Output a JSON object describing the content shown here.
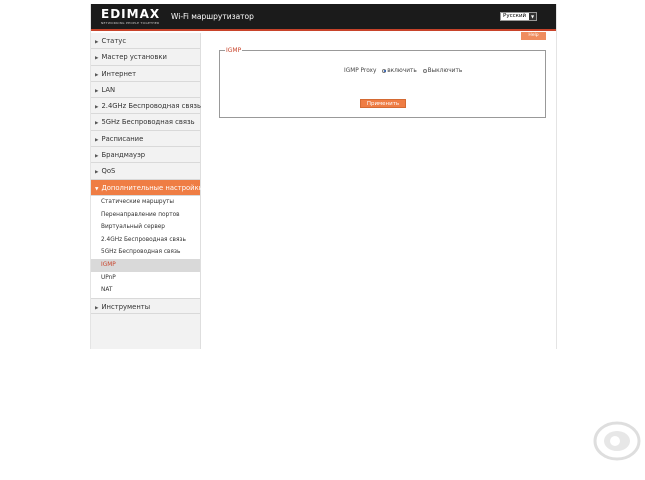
{
  "header": {
    "logo_text": "EDIMAX",
    "logo_tagline": "NETWORKING PEOPLE TOGETHER",
    "title": "Wi-Fi маршрутизатор",
    "language": "Русский"
  },
  "help_label": "Help",
  "sidebar": {
    "items": [
      {
        "label": "Статус"
      },
      {
        "label": "Мастер установки"
      },
      {
        "label": "Интернет"
      },
      {
        "label": "LAN"
      },
      {
        "label": "2.4GHz Беспроводная связь"
      },
      {
        "label": "5GHz Беспроводная связь"
      },
      {
        "label": "Расписание"
      },
      {
        "label": "Брандмауэр"
      },
      {
        "label": "QoS"
      },
      {
        "label": "Дополнительные настройки"
      }
    ],
    "submenu": [
      {
        "label": "Статические маршруты"
      },
      {
        "label": "Перенаправление портов"
      },
      {
        "label": "Виртуальный сервер"
      },
      {
        "label": "2.4GHz Беспроводная связь"
      },
      {
        "label": "5GHz Беспроводная связь"
      },
      {
        "label": "IGMP"
      },
      {
        "label": "UPnP"
      },
      {
        "label": "NAT"
      }
    ],
    "tools_label": "Инструменты"
  },
  "panel": {
    "legend": "IGMP",
    "proxy_label": "IGMP Proxy",
    "option_on": "включить",
    "option_off": "Выключить",
    "selected": "on",
    "apply_label": "Применить"
  },
  "colors": {
    "accent": "#ef7d44",
    "header_bg": "#1b1b1b",
    "header_line": "#c8432a"
  }
}
